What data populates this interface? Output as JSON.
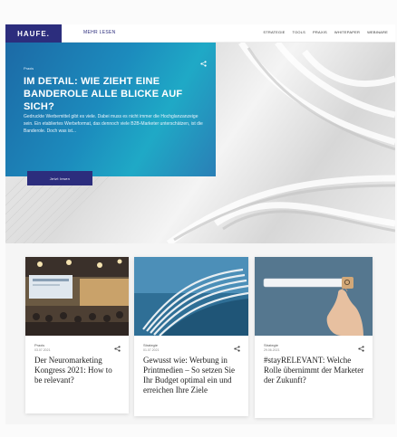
{
  "header": {
    "logo": "HAUFE.",
    "sublink": "MEHR LESEN",
    "nav": [
      "STRATEGIE",
      "TOOLS",
      "PRAXIS",
      "WHITEPAPER",
      "WEBINARE"
    ]
  },
  "hero": {
    "category": "Praxis",
    "title": "IM DETAIL: WIE ZIEHT EINE BANDEROLE ALLE BLICKE AUF SICH?",
    "teaser": "Gedruckte Werbemittel gibt es viele. Dabei muss es nicht immer die Hochglanzanzeige sein. Ein etabliertes Werbeformat, das dennoch viele B2B-Marketer unterschätzen, ist die Banderole. Doch was ist...",
    "button": "Jetzt lesen",
    "share_icon": "share-icon"
  },
  "cards": [
    {
      "category": "Praxis",
      "date": "03.07.2021",
      "title": "Der Neuromarketing Kongress 2021: How to be relevant?"
    },
    {
      "category": "Strategie",
      "date": "01.07.2021",
      "title": "Gewusst wie: Werbung in Printmedien – So setzen Sie Ihr Budget optimal ein und erreichen Ihre Ziele"
    },
    {
      "category": "Strategie",
      "date": "29.06.2021",
      "title": "#stayRELEVANT: Welche Rolle übernimmt der Marketer der Zukunft?"
    }
  ],
  "colors": {
    "brand": "#2c2d7d",
    "hero_gradient_start": "#1c6aa6",
    "hero_gradient_end": "#1fa9c6"
  }
}
